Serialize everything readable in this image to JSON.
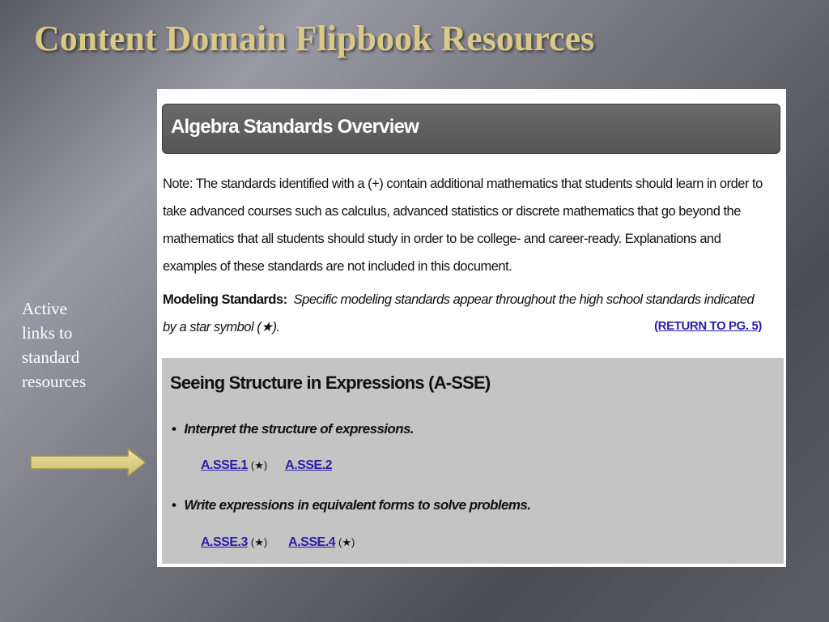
{
  "slide": {
    "title": "Content Domain Flipbook Resources",
    "caption_lines": [
      "Active",
      "links to",
      "standard",
      "resources"
    ],
    "title_color": "#d9c887",
    "arrow_color": "#d8cc7c"
  },
  "document": {
    "header_title": "Algebra Standards Overview",
    "note_text": "Note:  The standards identified with a (+)  contain additional mathematics that students should learn in order to take advanced courses such as calculus, advanced statistics or discrete mathematics that go beyond the mathematics that all students should study in order to be college- and career-ready.  Explanations and examples of these standards are not included in this document.",
    "modeling_label": "Modeling Standards:",
    "modeling_text": "Specific modeling standards appear throughout the high school standards indicated by a star symbol  (★).",
    "return_link": "(RETURN TO PG. 5)",
    "section": {
      "heading": "Seeing Structure in Expressions   (A-SSE)",
      "bullet_glyph": "•",
      "groups": [
        {
          "title": "Interpret the structure of expressions.",
          "links": [
            {
              "label": "A.SSE.1",
              "star": "(★)"
            },
            {
              "label": "A.SSE.2",
              "star": ""
            }
          ]
        },
        {
          "title": "Write expressions in equivalent forms to solve problems.",
          "links": [
            {
              "label": "A.SSE.3",
              "star": "(★)"
            },
            {
              "label": "A.SSE.4",
              "star": "(★)"
            }
          ]
        }
      ]
    },
    "link_color": "#2a1ea8"
  }
}
